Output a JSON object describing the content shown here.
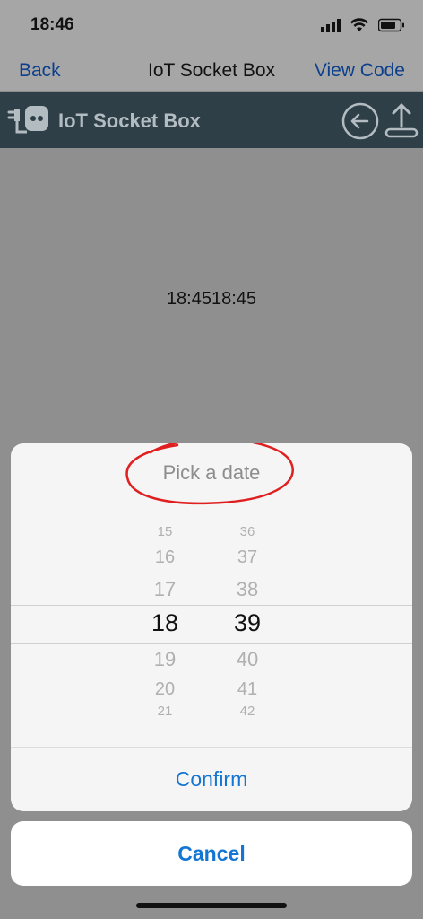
{
  "status_bar": {
    "time": "18:46"
  },
  "nav": {
    "back_label": "Back",
    "title": "IoT Socket Box",
    "view_code_label": "View Code"
  },
  "app_header": {
    "title": "IoT Socket Box"
  },
  "main": {
    "clock_text": "18:4518:45"
  },
  "picker_sheet": {
    "title": "Pick a date",
    "hours": [
      "15",
      "16",
      "17",
      "18",
      "19",
      "20",
      "21"
    ],
    "minutes": [
      "36",
      "37",
      "38",
      "39",
      "40",
      "41",
      "42"
    ],
    "selected_hour": "18",
    "selected_minute": "39",
    "confirm_label": "Confirm"
  },
  "cancel_label": "Cancel",
  "colors": {
    "header_bg": "#2e3f48",
    "link_blue": "#1476d2",
    "nav_link": "#0c3f8c",
    "annotation_red": "#e02020"
  }
}
